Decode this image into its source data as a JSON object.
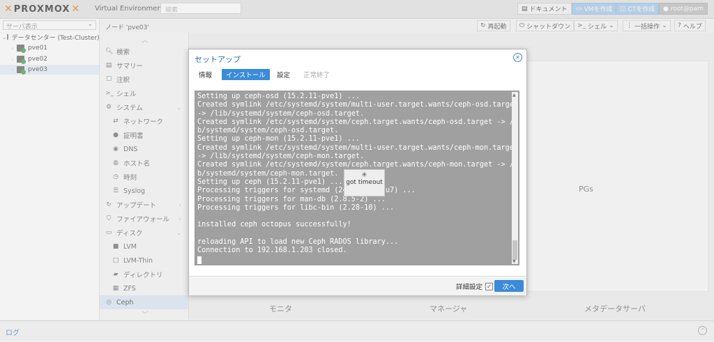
{
  "topbar": {
    "brand": "PROXMOX",
    "version": "Virtual Environment 6.4-5",
    "search_placeholder": "検索",
    "docs_label": "ドキュメント",
    "create_vm_label": "VMを作成",
    "create_ct_label": "CTを作成",
    "user_label": "root@pam"
  },
  "sidebar": {
    "view_label": "サーバ表示",
    "datacenter": "データセンター (Test-Cluster)",
    "nodes": [
      "pve01",
      "pve02",
      "pve03"
    ]
  },
  "header": {
    "node_title": "ノード 'pve03'",
    "reboot_label": "再起動",
    "shutdown_label": "シャットダウン",
    "shell_label": "シェル",
    "bulk_label": "一括操作",
    "help_label": "ヘルプ"
  },
  "menu": {
    "items": [
      {
        "icon": "search-icon",
        "label": "検索"
      },
      {
        "icon": "book-icon",
        "label": "サマリー"
      },
      {
        "icon": "note-icon",
        "label": "注釈"
      },
      {
        "icon": "terminal-icon",
        "label": "シェル"
      },
      {
        "icon": "gear-icon",
        "label": "システム"
      },
      {
        "icon": "network-icon",
        "label": "ネットワーク"
      },
      {
        "icon": "cert-icon",
        "label": "証明書"
      },
      {
        "icon": "globe-icon",
        "label": "DNS"
      },
      {
        "icon": "host-icon",
        "label": "ホスト名"
      },
      {
        "icon": "clock-icon",
        "label": "時刻"
      },
      {
        "icon": "list-icon",
        "label": "Syslog"
      },
      {
        "icon": "refresh-icon",
        "label": "アップデート"
      },
      {
        "icon": "shield-icon",
        "label": "ファイアウォール"
      },
      {
        "icon": "disk-icon",
        "label": "ディスク"
      },
      {
        "icon": "square-icon",
        "label": "LVM"
      },
      {
        "icon": "square-outline-icon",
        "label": "LVM-Thin"
      },
      {
        "icon": "folder-icon",
        "label": "ディレクトリ"
      },
      {
        "icon": "grid-icon",
        "label": "ZFS"
      },
      {
        "icon": "ceph-icon",
        "label": "Ceph"
      }
    ]
  },
  "content": {
    "pgs_label": "PGs",
    "monitor_label": "モニタ",
    "manager_label": "マネージャ",
    "mds_label": "メタデータサーバ"
  },
  "dialog": {
    "title": "セットアップ",
    "tabs": [
      "情報",
      "インストール",
      "設定",
      "正常終了"
    ],
    "terminal_lines": [
      "Setting up ceph-osd (15.2.11-pve1) ...",
      "Created symlink /etc/systemd/system/multi-user.target.wants/ceph-osd.target",
      "-> /lib/systemd/system/ceph-osd.target.",
      "Created symlink /etc/systemd/system/ceph.target.wants/ceph-osd.target -> /li",
      "b/systemd/system/ceph-osd.target.",
      "Setting up ceph-mon (15.2.11-pve1) ...",
      "Created symlink /etc/systemd/system/multi-user.target.wants/ceph-mon.target",
      "-> /lib/systemd/system/ceph-mon.target.",
      "Created symlink /etc/systemd/system/ceph.target.wants/ceph-mon.target -> /li",
      "b/systemd/system/ceph-mon.target.",
      "Setting up ceph (15.2.11-pve1) ...",
      "Processing triggers for systemd (24         u7) ...",
      "Processing triggers for man-db (2.8.5-2) ...",
      "Processing triggers for libc-bin (2.28-10) ...",
      "",
      "installed ceph octopus successfully!",
      "",
      "reloading API to load new Ceph RADOS library...",
      "Connection to 192.168.1.203 closed."
    ],
    "loading_text": "got timeout",
    "advanced_label": "詳細設定",
    "next_label": "次へ"
  },
  "statusbar": {
    "log_label": "ログ"
  }
}
